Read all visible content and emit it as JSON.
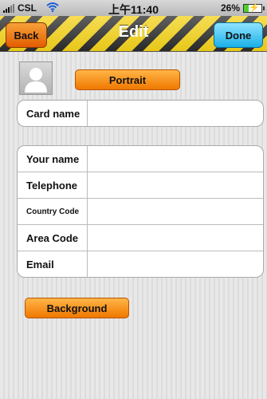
{
  "status": {
    "carrier": "CSL",
    "time": "上午11:40",
    "battery": "26%"
  },
  "nav": {
    "title": "Edit",
    "back_label": "Back",
    "done_label": "Done"
  },
  "buttons": {
    "portrait": "Portrait",
    "background": "Background"
  },
  "card_group": [
    {
      "label": "Card name",
      "value": ""
    }
  ],
  "contact_group": [
    {
      "label": "Your name",
      "value": ""
    },
    {
      "label": "Telephone",
      "value": ""
    },
    {
      "label": "Country Code",
      "value": ""
    },
    {
      "label": "Area Code",
      "value": ""
    },
    {
      "label": "Email",
      "value": ""
    }
  ],
  "colors": {
    "nav_stripe_yellow": "#f3d21a",
    "nav_stripe_dark": "#2b2b2b",
    "orange_button": "#f07800",
    "blue_button": "#1ab0e8"
  },
  "icons": [
    "signal-icon",
    "wifi-icon",
    "battery-icon",
    "avatar-placeholder-icon"
  ]
}
